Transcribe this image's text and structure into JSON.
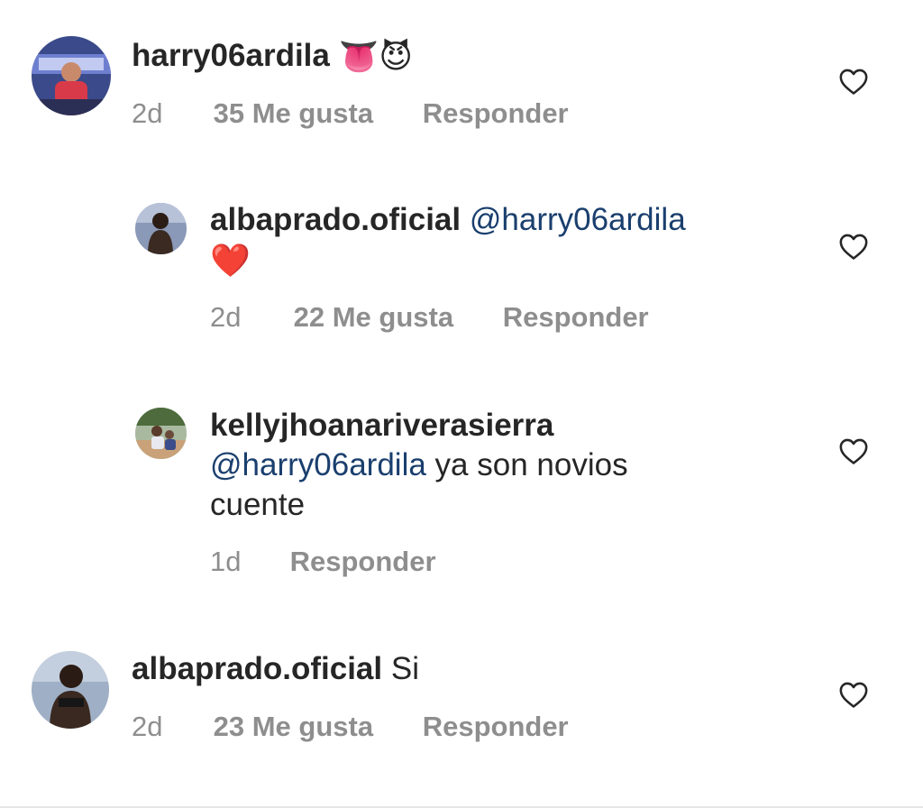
{
  "comments": [
    {
      "username": "harry06ardila",
      "text": "",
      "emoji": "👅😈",
      "time": "2d",
      "likes": "35 Me gusta",
      "reply": "Responder"
    },
    {
      "username": "albaprado.oficial",
      "mention": "@harry06ardila",
      "emoji": "❤️",
      "time": "2d",
      "likes": "22 Me gusta",
      "reply": "Responder"
    },
    {
      "username": "kellyjhoanariverasierra",
      "mention": "@harry06ardila",
      "text": "ya son novios",
      "text2": "cuente",
      "time": "1d",
      "reply": "Responder"
    },
    {
      "username": "albaprado.oficial",
      "text": "Si",
      "time": "2d",
      "likes": "23 Me gusta",
      "reply": "Responder"
    }
  ],
  "icons": {
    "like": "heart-outline-icon"
  },
  "colors": {
    "mention": "#1a3f6e",
    "meta": "#8e8e8e",
    "text": "#262626"
  }
}
